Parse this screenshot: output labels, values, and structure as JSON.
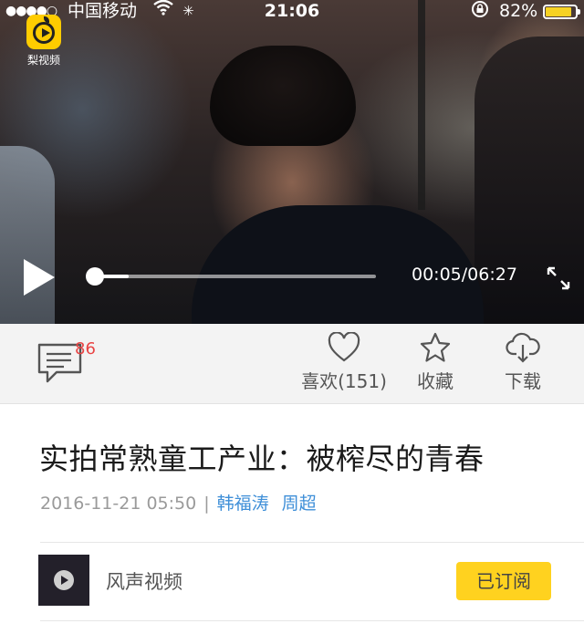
{
  "status_bar": {
    "signal": "●●●●○",
    "carrier": "中国移动",
    "time": "21:06",
    "battery_percent": "82%",
    "battery_level": 0.82,
    "battery_color": "#f7d224"
  },
  "app": {
    "logo_text": "梨视频",
    "logo_icon": "pear-video-logo-icon",
    "brand_color": "#ffcc00"
  },
  "player": {
    "elapsed": "00:05",
    "duration": "06:27",
    "time_readout": "00:05/06:27",
    "progress_fraction": 0.013,
    "buffered_fraction": 0.13,
    "play_icon": "play-icon",
    "fullscreen_icon": "fullscreen-icon"
  },
  "actions": {
    "comment_count": "86",
    "comment_icon": "comment-icon",
    "like_label": "喜欢(151)",
    "like_icon": "heart-icon",
    "favorite_label": "收藏",
    "favorite_icon": "star-icon",
    "download_label": "下载",
    "download_icon": "cloud-download-icon",
    "badge_color": "#e94343"
  },
  "article": {
    "title": "实拍常熟童工产业：被榨尽的青春",
    "date": "2016-11-21 05:50",
    "separator": "|",
    "authors": [
      "韩福涛",
      "周超"
    ],
    "author_color": "#3f8fd8"
  },
  "channel": {
    "name": "风声视频",
    "subscribe_label": "已订阅",
    "subscribe_color": "#ffd21f"
  }
}
